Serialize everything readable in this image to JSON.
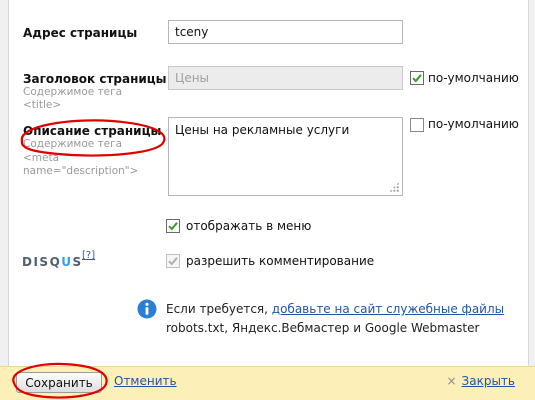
{
  "page_address": {
    "label": "Адрес страницы",
    "value": "tceny"
  },
  "page_title": {
    "label": "Заголовок страницы",
    "hint_line1": "Содержимое тега",
    "hint_line2": "<title>",
    "value": "Цены",
    "default_checkbox_label": "по-умолчанию",
    "default_checked": true
  },
  "page_description": {
    "label": "Описание страницы",
    "hint_line1": "Содержимое тега",
    "hint_line2": "<meta",
    "hint_line3": "name=\"description\">",
    "value": "Цены на рекламные услуги",
    "default_checkbox_label": "по-умолчанию",
    "default_checked": false
  },
  "show_in_menu": {
    "label": "отображать в меню",
    "checked": true
  },
  "disqus": {
    "logo_pre": "DISQ",
    "logo_u": "U",
    "logo_post": "S",
    "help_link": "[?]",
    "allow_comments_label": "разрешить комментирование",
    "allow_comments_checked": true
  },
  "info": {
    "text_before": "Если требуется, ",
    "link": "добавьте на сайт служебные файлы",
    "line2": "robots.txt, Яндекс.Вебмастер и Google Webmaster"
  },
  "footer": {
    "save_label": "Сохранить",
    "cancel_label": "Отменить",
    "close_label": "Закрыть",
    "close_icon_glyph": "×"
  },
  "colors": {
    "accent_link": "#2255aa",
    "footer_bg": "#fcefb8",
    "annotation_red": "#e00000",
    "checkmark_green": "#3a9a2a",
    "info_blue": "#2a7fd4"
  }
}
